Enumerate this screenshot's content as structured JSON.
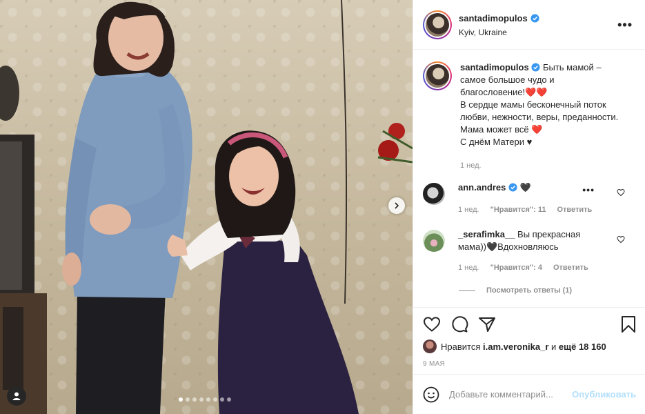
{
  "post": {
    "username": "santadimopulos",
    "location": "Kyiv, Ukraine",
    "more_glyph": "•••",
    "icons": {
      "more": "more-options-icon",
      "verified": "verified-badge-icon",
      "next": "chevron-right-icon",
      "tag": "user-tag-icon"
    },
    "carousel": {
      "count": 8,
      "active": 0
    }
  },
  "caption": {
    "username": "santadimopulos",
    "text": "Быть мамой – самое большое чудо и благословение!❤️❤️\nВ сердце мамы бесконечный поток любви, нежности, веры, преданности. Мама может всё ❤️\nС днём Матери ♥",
    "time": "1 нед."
  },
  "comments": [
    {
      "username": "ann.andres",
      "verified": true,
      "text": " 🖤",
      "time": "1 нед.",
      "likes": "\"Нравится\": 11",
      "reply": "Ответить",
      "more_glyph": "•••"
    },
    {
      "username": "_serafimka__",
      "verified": false,
      "text": " Вы прекрасная мама))🖤Вдохновляюсь",
      "time": "1 нед.",
      "likes": "\"Нравится\": 4",
      "reply": "Ответить",
      "view_replies": "Посмотреть ответы (1)"
    }
  ],
  "actions": {
    "icons": [
      "heart-icon",
      "comment-icon",
      "share-icon",
      "bookmark-icon"
    ]
  },
  "likes": {
    "prefix": "Нравится",
    "user": "i.am.veronika_r",
    "joiner": "и",
    "others": "ещё 18 160"
  },
  "date": "9 МАЯ",
  "add_comment": {
    "placeholder": "Добавьте комментарий...",
    "publish": "Опубликовать"
  },
  "colors": {
    "accent_blue": "#0095f6",
    "publish_disabled": "#b2dffc",
    "muted_text": "#8e8e8e",
    "border": "#efefef"
  }
}
